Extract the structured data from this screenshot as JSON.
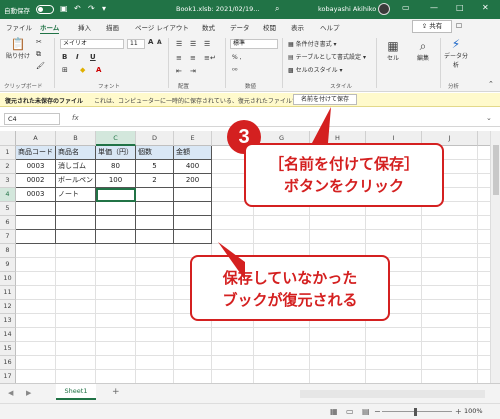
{
  "titlebar": {
    "autosave_label": "自動保存",
    "autosave_state": "オフ",
    "document": "Book1.xlsb: 2021/02/19...",
    "user": "kobayashi Akihiko"
  },
  "menu": {
    "tabs": [
      "ファイル",
      "ホーム",
      "挿入",
      "描画",
      "ページ レイアウト",
      "数式",
      "データ",
      "校閲",
      "表示",
      "ヘルプ"
    ],
    "active": "ホーム",
    "share": "共有",
    "comment": "☐"
  },
  "ribbon": {
    "paste": "貼り付け",
    "font_name": "メイリオ",
    "font_size": "11",
    "bold": "B",
    "italic": "I",
    "underline": "U",
    "grow_font": "A",
    "shrink_font": "A",
    "number_format": "標準",
    "percent_row": "% ,",
    "conditional": "条件付き書式",
    "table_format": "テーブルとして書式設定",
    "cell_style": "セルのスタイル",
    "cells": "セル",
    "editing": "編集",
    "analyze": "データ分析",
    "groups": {
      "clipboard": "クリップボード",
      "font": "フォント",
      "alignment": "配置",
      "number": "数値",
      "style": "スタイル",
      "analysis": "分析"
    }
  },
  "infobar": {
    "title": "復元された未保存のファイル",
    "message": "これは、コンピューターに一時的に保存されている、復元されたファイルです。",
    "save_button": "名前を付けて保存"
  },
  "formula": {
    "namebox": "C4",
    "fx": "fx",
    "value": ""
  },
  "sheet": {
    "columns": [
      "A",
      "B",
      "C",
      "D",
      "E",
      "F",
      "G",
      "H",
      "I",
      "J",
      "K"
    ],
    "rows": [
      "1",
      "2",
      "3",
      "4",
      "5",
      "6",
      "7",
      "8",
      "9",
      "10",
      "11",
      "12",
      "13",
      "14",
      "15",
      "16",
      "17"
    ],
    "header": [
      "商品コード",
      "商品名",
      "単価（円）",
      "個数",
      "金額"
    ],
    "data": [
      [
        "0003",
        "消しゴム",
        "80",
        "5",
        "400"
      ],
      [
        "0002",
        "ボールペン",
        "100",
        "2",
        "200"
      ],
      [
        "0003",
        "ノート",
        "",
        "",
        ""
      ]
    ],
    "active_cell": "C4"
  },
  "tabs": {
    "sheet1": "Sheet1",
    "add": "+"
  },
  "status": {
    "zoom": "100%"
  },
  "annotations": {
    "step": "3",
    "callout1_line1": "［名前を付けて保存］",
    "callout1_line2": "ボタンをクリック",
    "callout2_line1": "保存していなかった",
    "callout2_line2": "ブックが復元される"
  },
  "colors": {
    "accent": "#217346",
    "annotation": "#d42020",
    "header_fill": "#d9e7f5"
  }
}
